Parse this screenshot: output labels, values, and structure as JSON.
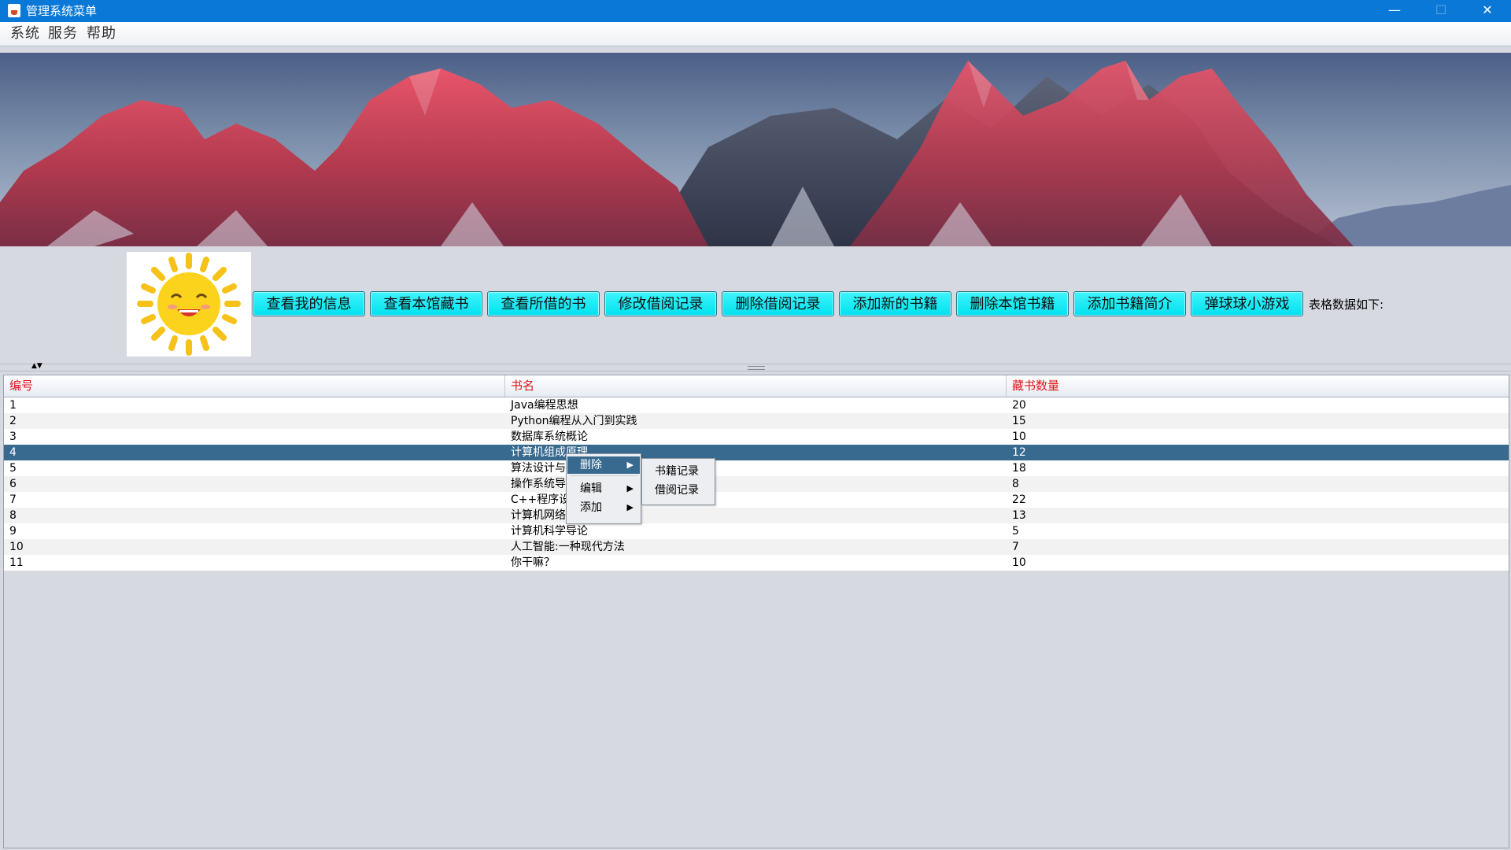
{
  "window": {
    "title": "管理系统菜单",
    "min_icon": "minimize-icon",
    "max_icon": "maximize-icon",
    "close_icon": "close-icon"
  },
  "menubar": {
    "items": [
      "系统",
      "服务",
      "帮助"
    ]
  },
  "toolbar": {
    "buttons": [
      "查看我的信息",
      "查看本馆藏书",
      "查看所借的书",
      "修改借阅记录",
      "删除借阅记录",
      "添加新的书籍",
      "删除本馆书籍",
      "添加书籍简介",
      "弹球球小游戏"
    ],
    "table_caption": "表格数据如下:",
    "button_color": "#00e8f4"
  },
  "table": {
    "columns": [
      "编号",
      "书名",
      "藏书数量"
    ],
    "header_color": "#e0161c",
    "selected_row_color": "#386a90",
    "rows": [
      [
        "1",
        "Java编程思想",
        "20"
      ],
      [
        "2",
        "Python编程从入门到实践",
        "15"
      ],
      [
        "3",
        "数据库系统概论",
        "10"
      ],
      [
        "4",
        "计算机组成原理",
        "12"
      ],
      [
        "5",
        "算法设计与",
        "18"
      ],
      [
        "6",
        "操作系统导",
        "8"
      ],
      [
        "7",
        "C++程序设",
        "22"
      ],
      [
        "8",
        "计算机网络",
        "13"
      ],
      [
        "9",
        "计算机科学导论",
        "5"
      ],
      [
        "10",
        "人工智能:一种现代方法",
        "7"
      ],
      [
        "11",
        "你干嘛？",
        "10"
      ]
    ],
    "selected_row": 4
  },
  "context_menu": {
    "items": [
      "删除",
      "编辑",
      "添加"
    ],
    "active_item": "删除",
    "submenu": [
      "书籍记录",
      "借阅记录"
    ]
  }
}
